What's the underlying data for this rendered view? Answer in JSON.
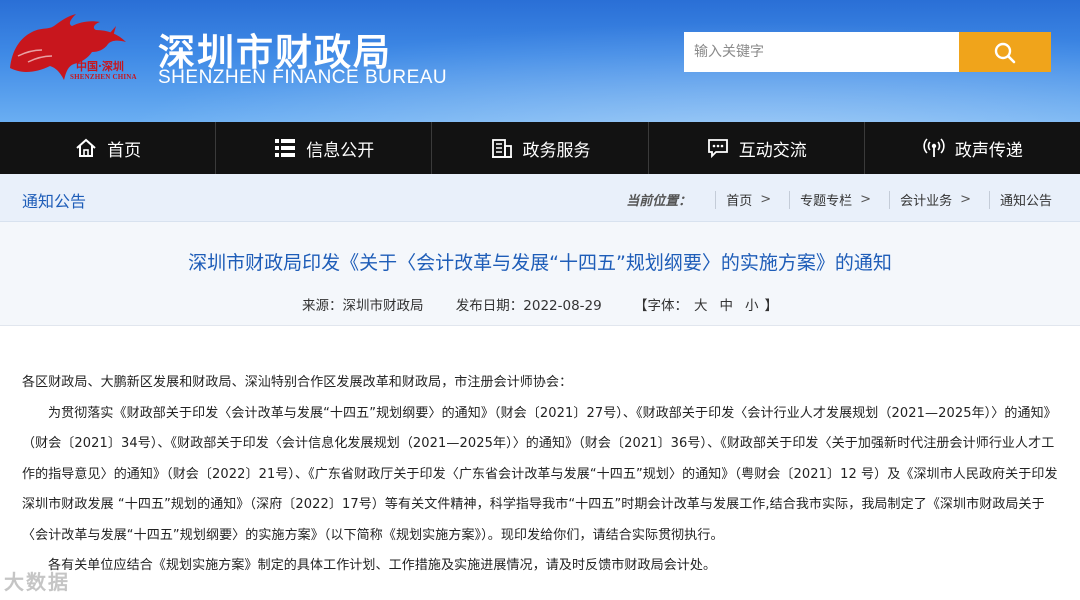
{
  "header": {
    "logo": {
      "caption_cn": "中国·深圳",
      "caption_en": "SHENZHEN CHINA"
    },
    "title": "深圳市财政局",
    "subtitle": "SHENZHEN FINANCE BUREAU",
    "search": {
      "placeholder": "输入关键字",
      "button_icon": "search-icon"
    },
    "colors": {
      "gradient_top": "#2a6fd6",
      "gradient_bottom": "#6aaef2",
      "search_button": "#f0a41b"
    }
  },
  "nav": {
    "items": [
      {
        "label": "首页",
        "icon": "home-icon"
      },
      {
        "label": "信息公开",
        "icon": "list-icon"
      },
      {
        "label": "政务服务",
        "icon": "building-icon"
      },
      {
        "label": "互动交流",
        "icon": "chat-icon"
      },
      {
        "label": "政声传递",
        "icon": "broadcast-icon"
      }
    ]
  },
  "breadcrumb": {
    "section": "通知公告",
    "current_label": "当前位置：",
    "items": [
      "首页",
      "专题专栏",
      "会计业务",
      "通知公告"
    ],
    "separator": ">"
  },
  "article": {
    "title": "深圳市财政局印发《关于〈会计改革与发展“十四五”规划纲要〉的实施方案》的通知",
    "source": "来源：深圳市财政局",
    "date": "发布日期：2022-08-29",
    "font_size_label_open": "【字体：",
    "font_sizes": [
      "大",
      "中",
      "小"
    ],
    "font_size_label_close": "】",
    "paragraphs": [
      "各区财政局、大鹏新区发展和财政局、深汕特别合作区发展改革和财政局，市注册会计师协会：",
      "为贯彻落实《财政部关于印发〈会计改革与发展“十四五”规划纲要〉的通知》（财会〔2021〕27号）、《财政部关于印发〈会计行业人才发展规划（2021—2025年）〉的通知》（财会〔2021〕34号）、《财政部关于印发〈会计信息化发展规划（2021—2025年）〉的通知》（财会〔2021〕36号）、《财政部关于印发〈关于加强新时代注册会计师行业人才工作的指导意见〉的通知》（财会〔2022〕21号）、《广东省财政厅关于印发〈广东省会计改革与发展“十四五”规划〉的通知》（粤财会〔2021〕12 号）及《深圳市人民政府关于印发深圳市财政发展 “十四五”规划的通知》（深府〔2022〕17号）等有关文件精神，科学指导我市“十四五”时期会计改革与发展工作,结合我市实际，我局制定了《深圳市财政局关于〈会计改革与发展“十四五”规划纲要〉的实施方案》（以下简称《规划实施方案》）。现印发给你们，请结合实际贯彻执行。",
      "各有关单位应结合《规划实施方案》制定的具体工作计划、工作措施及实施进展情况，请及时反馈市财政局会计处。"
    ]
  },
  "watermark": "大数据"
}
